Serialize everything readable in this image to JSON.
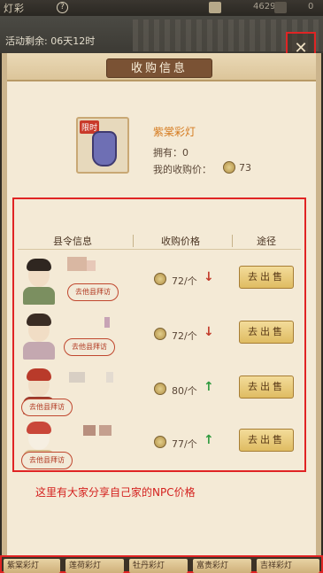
{
  "topbar": {
    "title": "灯彩",
    "help": "?",
    "coins": "46290",
    "right_value": "0"
  },
  "event": {
    "label": "活动剩余: 06天12时"
  },
  "panel": {
    "title": "收购信息",
    "close": "✕"
  },
  "item": {
    "tag": "限时",
    "name": "紫棠彩灯",
    "owned": "拥有：0",
    "buy_label": "我的收购价：",
    "buy_price": "73"
  },
  "table": {
    "headers": [
      "县令信息",
      "收购价格",
      "途径"
    ],
    "badge_text": "去他县拜访",
    "sell_label": "去出售",
    "rows": [
      {
        "price": "72/个",
        "trend": "down",
        "trend_icon": "↓"
      },
      {
        "price": "72/个",
        "trend": "down",
        "trend_icon": "↓"
      },
      {
        "price": "80/个",
        "trend": "up",
        "trend_icon": "↑"
      },
      {
        "price": "77/个",
        "trend": "up",
        "trend_icon": "↑"
      }
    ]
  },
  "note": "这里有大家分享自己家的NPC价格",
  "tabs": [
    "紫棠彩灯",
    "莲荷彩灯",
    "牡丹彩灯",
    "富贵彩灯",
    "吉祥彩灯"
  ],
  "colors": {
    "accent_red": "#e02424",
    "header_brown": "#7a5234",
    "price_down": "#c23b2b",
    "price_up": "#2f9a3e"
  }
}
